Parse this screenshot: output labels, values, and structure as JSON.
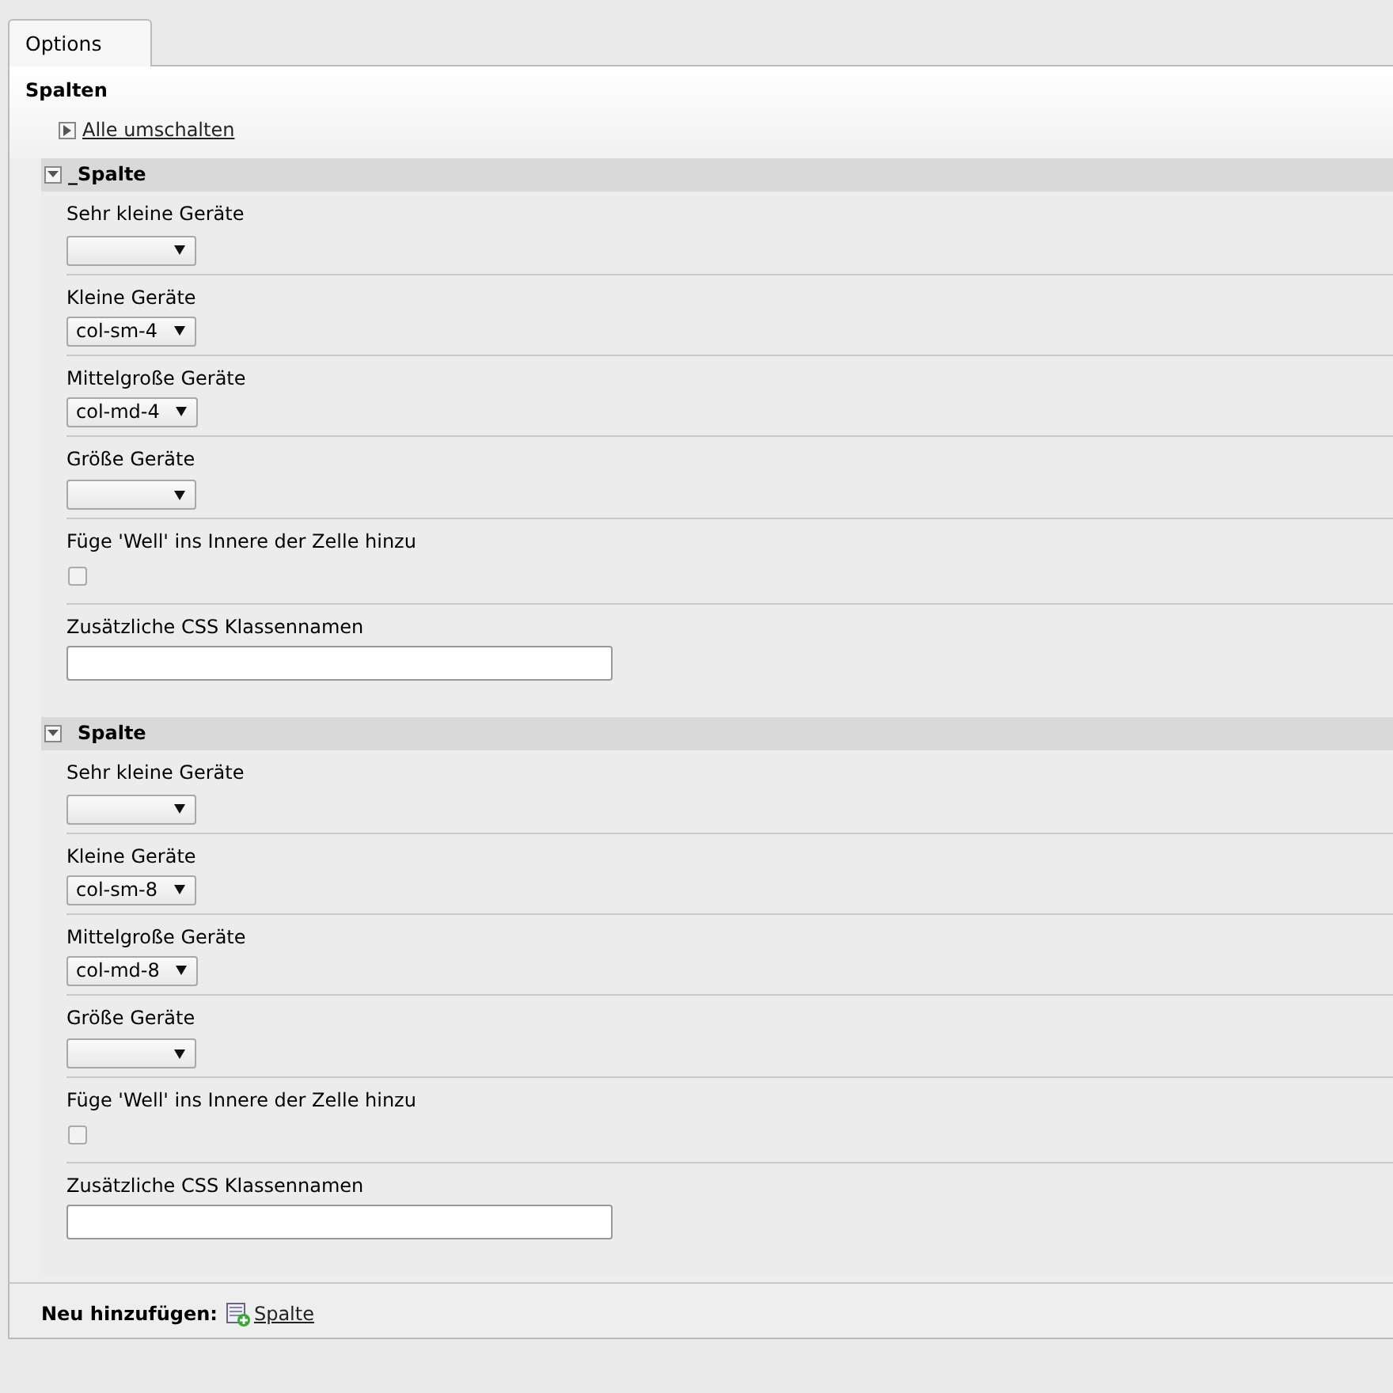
{
  "tabs": [
    {
      "label": "Options",
      "selected": true
    }
  ],
  "panel": {
    "title": "Spalten",
    "toggle_all": "Alle umschalten",
    "sections": [
      {
        "title": "_Spalte",
        "expanded": true,
        "fields": [
          {
            "kind": "select",
            "label": "Sehr kleine Geräte"
          },
          {
            "kind": "select",
            "label": "Kleine Geräte",
            "value": "col-sm-4"
          },
          {
            "kind": "select",
            "label": "Mittelgroße Geräte",
            "value": "col-md-4"
          },
          {
            "kind": "select",
            "label": "Größe Geräte"
          },
          {
            "kind": "checkbox",
            "label": "Füge 'Well' ins Innere der Zelle hinzu",
            "checked": false
          },
          {
            "kind": "text",
            "label": "Zusätzliche CSS Klassennamen"
          }
        ]
      },
      {
        "title": "Spalte",
        "expanded": true,
        "fields": [
          {
            "kind": "select",
            "label": "Sehr kleine Geräte"
          },
          {
            "kind": "select",
            "label": "Kleine Geräte",
            "value": "col-sm-8"
          },
          {
            "kind": "select",
            "label": "Mittelgroße Geräte",
            "value": "col-md-8"
          },
          {
            "kind": "select",
            "label": "Größe Geräte"
          },
          {
            "kind": "checkbox",
            "label": "Füge 'Well' ins Innere der Zelle hinzu",
            "checked": false
          },
          {
            "kind": "text",
            "label": "Zusätzliche CSS Klassennamen"
          }
        ]
      }
    ],
    "footer": {
      "label": "Neu hinzufügen:",
      "link": "Spalte"
    }
  }
}
